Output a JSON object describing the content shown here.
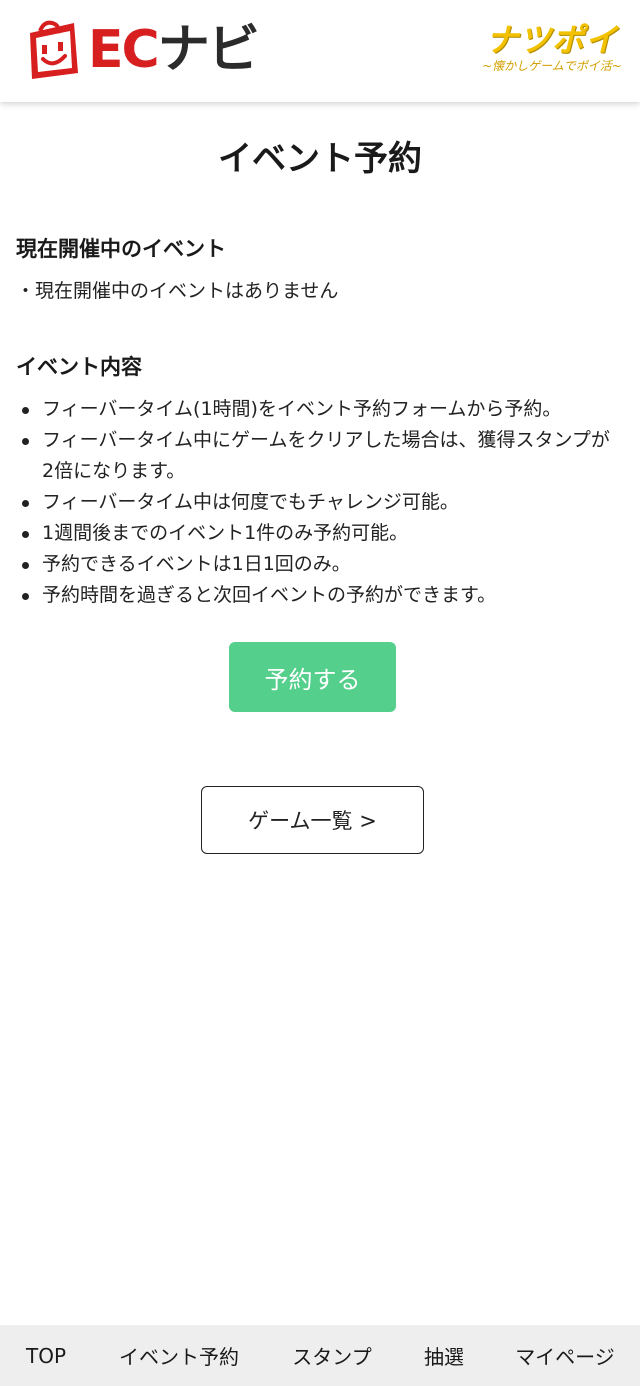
{
  "header": {
    "ec_logo_prefix": "EC",
    "ec_logo_suffix": "ナビ",
    "partner_title": "ナツポイ",
    "partner_subtitle": "~懐かしゲームでポイ活~"
  },
  "page": {
    "title": "イベント予約"
  },
  "current_event": {
    "heading": "現在開催中のイベント",
    "status": "・現在開催中のイベントはありません"
  },
  "event_details": {
    "heading": "イベント内容",
    "items": [
      "フィーバータイム(1時間)をイベント予約フォームから予約。",
      "フィーバータイム中にゲームをクリアした場合は、獲得スタンプが2倍になります。",
      "フィーバータイム中は何度でもチャレンジ可能。",
      "1週間後までのイベント1件のみ予約可能。",
      "予約できるイベントは1日1回のみ。",
      "予約時間を過ぎると次回イベントの予約ができます。"
    ]
  },
  "buttons": {
    "reserve_label": "予約する",
    "game_list_label": "ゲーム一覧 >"
  },
  "tabbar": {
    "items": [
      "TOP",
      "イベント予約",
      "スタンプ",
      "抽選",
      "マイページ"
    ]
  },
  "colors": {
    "brand_red": "#d71f1f",
    "reserve_green": "#55cf8c",
    "partner_yellow": "#f2c200"
  }
}
